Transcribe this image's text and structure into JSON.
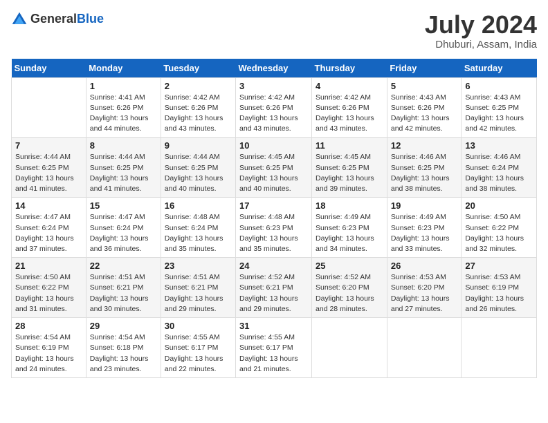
{
  "header": {
    "logo_general": "General",
    "logo_blue": "Blue",
    "month_year": "July 2024",
    "location": "Dhuburi, Assam, India"
  },
  "calendar": {
    "days_of_week": [
      "Sunday",
      "Monday",
      "Tuesday",
      "Wednesday",
      "Thursday",
      "Friday",
      "Saturday"
    ],
    "weeks": [
      [
        {
          "day": "",
          "sunrise": "",
          "sunset": "",
          "daylight": ""
        },
        {
          "day": "1",
          "sunrise": "Sunrise: 4:41 AM",
          "sunset": "Sunset: 6:26 PM",
          "daylight": "Daylight: 13 hours and 44 minutes."
        },
        {
          "day": "2",
          "sunrise": "Sunrise: 4:42 AM",
          "sunset": "Sunset: 6:26 PM",
          "daylight": "Daylight: 13 hours and 43 minutes."
        },
        {
          "day": "3",
          "sunrise": "Sunrise: 4:42 AM",
          "sunset": "Sunset: 6:26 PM",
          "daylight": "Daylight: 13 hours and 43 minutes."
        },
        {
          "day": "4",
          "sunrise": "Sunrise: 4:42 AM",
          "sunset": "Sunset: 6:26 PM",
          "daylight": "Daylight: 13 hours and 43 minutes."
        },
        {
          "day": "5",
          "sunrise": "Sunrise: 4:43 AM",
          "sunset": "Sunset: 6:26 PM",
          "daylight": "Daylight: 13 hours and 42 minutes."
        },
        {
          "day": "6",
          "sunrise": "Sunrise: 4:43 AM",
          "sunset": "Sunset: 6:25 PM",
          "daylight": "Daylight: 13 hours and 42 minutes."
        }
      ],
      [
        {
          "day": "7",
          "sunrise": "Sunrise: 4:44 AM",
          "sunset": "Sunset: 6:25 PM",
          "daylight": "Daylight: 13 hours and 41 minutes."
        },
        {
          "day": "8",
          "sunrise": "Sunrise: 4:44 AM",
          "sunset": "Sunset: 6:25 PM",
          "daylight": "Daylight: 13 hours and 41 minutes."
        },
        {
          "day": "9",
          "sunrise": "Sunrise: 4:44 AM",
          "sunset": "Sunset: 6:25 PM",
          "daylight": "Daylight: 13 hours and 40 minutes."
        },
        {
          "day": "10",
          "sunrise": "Sunrise: 4:45 AM",
          "sunset": "Sunset: 6:25 PM",
          "daylight": "Daylight: 13 hours and 40 minutes."
        },
        {
          "day": "11",
          "sunrise": "Sunrise: 4:45 AM",
          "sunset": "Sunset: 6:25 PM",
          "daylight": "Daylight: 13 hours and 39 minutes."
        },
        {
          "day": "12",
          "sunrise": "Sunrise: 4:46 AM",
          "sunset": "Sunset: 6:25 PM",
          "daylight": "Daylight: 13 hours and 38 minutes."
        },
        {
          "day": "13",
          "sunrise": "Sunrise: 4:46 AM",
          "sunset": "Sunset: 6:24 PM",
          "daylight": "Daylight: 13 hours and 38 minutes."
        }
      ],
      [
        {
          "day": "14",
          "sunrise": "Sunrise: 4:47 AM",
          "sunset": "Sunset: 6:24 PM",
          "daylight": "Daylight: 13 hours and 37 minutes."
        },
        {
          "day": "15",
          "sunrise": "Sunrise: 4:47 AM",
          "sunset": "Sunset: 6:24 PM",
          "daylight": "Daylight: 13 hours and 36 minutes."
        },
        {
          "day": "16",
          "sunrise": "Sunrise: 4:48 AM",
          "sunset": "Sunset: 6:24 PM",
          "daylight": "Daylight: 13 hours and 35 minutes."
        },
        {
          "day": "17",
          "sunrise": "Sunrise: 4:48 AM",
          "sunset": "Sunset: 6:23 PM",
          "daylight": "Daylight: 13 hours and 35 minutes."
        },
        {
          "day": "18",
          "sunrise": "Sunrise: 4:49 AM",
          "sunset": "Sunset: 6:23 PM",
          "daylight": "Daylight: 13 hours and 34 minutes."
        },
        {
          "day": "19",
          "sunrise": "Sunrise: 4:49 AM",
          "sunset": "Sunset: 6:23 PM",
          "daylight": "Daylight: 13 hours and 33 minutes."
        },
        {
          "day": "20",
          "sunrise": "Sunrise: 4:50 AM",
          "sunset": "Sunset: 6:22 PM",
          "daylight": "Daylight: 13 hours and 32 minutes."
        }
      ],
      [
        {
          "day": "21",
          "sunrise": "Sunrise: 4:50 AM",
          "sunset": "Sunset: 6:22 PM",
          "daylight": "Daylight: 13 hours and 31 minutes."
        },
        {
          "day": "22",
          "sunrise": "Sunrise: 4:51 AM",
          "sunset": "Sunset: 6:21 PM",
          "daylight": "Daylight: 13 hours and 30 minutes."
        },
        {
          "day": "23",
          "sunrise": "Sunrise: 4:51 AM",
          "sunset": "Sunset: 6:21 PM",
          "daylight": "Daylight: 13 hours and 29 minutes."
        },
        {
          "day": "24",
          "sunrise": "Sunrise: 4:52 AM",
          "sunset": "Sunset: 6:21 PM",
          "daylight": "Daylight: 13 hours and 29 minutes."
        },
        {
          "day": "25",
          "sunrise": "Sunrise: 4:52 AM",
          "sunset": "Sunset: 6:20 PM",
          "daylight": "Daylight: 13 hours and 28 minutes."
        },
        {
          "day": "26",
          "sunrise": "Sunrise: 4:53 AM",
          "sunset": "Sunset: 6:20 PM",
          "daylight": "Daylight: 13 hours and 27 minutes."
        },
        {
          "day": "27",
          "sunrise": "Sunrise: 4:53 AM",
          "sunset": "Sunset: 6:19 PM",
          "daylight": "Daylight: 13 hours and 26 minutes."
        }
      ],
      [
        {
          "day": "28",
          "sunrise": "Sunrise: 4:54 AM",
          "sunset": "Sunset: 6:19 PM",
          "daylight": "Daylight: 13 hours and 24 minutes."
        },
        {
          "day": "29",
          "sunrise": "Sunrise: 4:54 AM",
          "sunset": "Sunset: 6:18 PM",
          "daylight": "Daylight: 13 hours and 23 minutes."
        },
        {
          "day": "30",
          "sunrise": "Sunrise: 4:55 AM",
          "sunset": "Sunset: 6:17 PM",
          "daylight": "Daylight: 13 hours and 22 minutes."
        },
        {
          "day": "31",
          "sunrise": "Sunrise: 4:55 AM",
          "sunset": "Sunset: 6:17 PM",
          "daylight": "Daylight: 13 hours and 21 minutes."
        },
        {
          "day": "",
          "sunrise": "",
          "sunset": "",
          "daylight": ""
        },
        {
          "day": "",
          "sunrise": "",
          "sunset": "",
          "daylight": ""
        },
        {
          "day": "",
          "sunrise": "",
          "sunset": "",
          "daylight": ""
        }
      ]
    ]
  }
}
